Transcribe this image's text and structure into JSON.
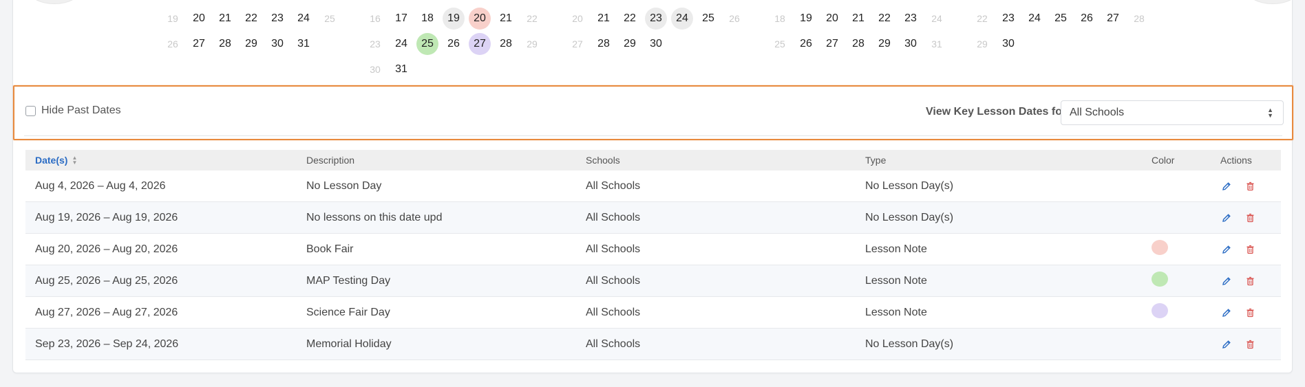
{
  "calendar": {
    "months": [
      {
        "weeks": [
          [
            {
              "d": "19",
              "m": true
            },
            {
              "d": "20"
            },
            {
              "d": "21"
            },
            {
              "d": "22"
            },
            {
              "d": "23"
            },
            {
              "d": "24"
            },
            {
              "d": "25",
              "m": true
            }
          ],
          [
            {
              "d": "26",
              "m": true
            },
            {
              "d": "27"
            },
            {
              "d": "28"
            },
            {
              "d": "29"
            },
            {
              "d": "30"
            },
            {
              "d": "31"
            },
            {
              "d": ""
            }
          ]
        ]
      },
      {
        "weeks": [
          [
            {
              "d": "16",
              "m": true
            },
            {
              "d": "17"
            },
            {
              "d": "18"
            },
            {
              "d": "19",
              "bg": "#ebebeb"
            },
            {
              "d": "20",
              "bg": "#f8d0ca"
            },
            {
              "d": "21"
            },
            {
              "d": "22",
              "m": true
            }
          ],
          [
            {
              "d": "23",
              "m": true
            },
            {
              "d": "24"
            },
            {
              "d": "25",
              "bg": "#bfe8b4"
            },
            {
              "d": "26"
            },
            {
              "d": "27",
              "bg": "#dcd3f5"
            },
            {
              "d": "28"
            },
            {
              "d": "29",
              "m": true
            }
          ],
          [
            {
              "d": "30",
              "m": true
            },
            {
              "d": "31"
            },
            {
              "d": ""
            },
            {
              "d": ""
            },
            {
              "d": ""
            },
            {
              "d": ""
            },
            {
              "d": ""
            }
          ]
        ]
      },
      {
        "weeks": [
          [
            {
              "d": "20",
              "m": true
            },
            {
              "d": "21"
            },
            {
              "d": "22"
            },
            {
              "d": "23",
              "bg": "#ebebeb"
            },
            {
              "d": "24",
              "bg": "#ebebeb"
            },
            {
              "d": "25"
            },
            {
              "d": "26",
              "m": true
            }
          ],
          [
            {
              "d": "27",
              "m": true
            },
            {
              "d": "28"
            },
            {
              "d": "29"
            },
            {
              "d": "30"
            },
            {
              "d": ""
            },
            {
              "d": ""
            },
            {
              "d": ""
            }
          ]
        ]
      },
      {
        "weeks": [
          [
            {
              "d": "18",
              "m": true
            },
            {
              "d": "19"
            },
            {
              "d": "20"
            },
            {
              "d": "21"
            },
            {
              "d": "22"
            },
            {
              "d": "23"
            },
            {
              "d": "24",
              "m": true
            }
          ],
          [
            {
              "d": "25",
              "m": true
            },
            {
              "d": "26"
            },
            {
              "d": "27"
            },
            {
              "d": "28"
            },
            {
              "d": "29"
            },
            {
              "d": "30"
            },
            {
              "d": "31",
              "m": true
            }
          ]
        ]
      },
      {
        "weeks": [
          [
            {
              "d": "22",
              "m": true
            },
            {
              "d": "23"
            },
            {
              "d": "24"
            },
            {
              "d": "25"
            },
            {
              "d": "26"
            },
            {
              "d": "27"
            },
            {
              "d": "28",
              "m": true
            }
          ],
          [
            {
              "d": "29",
              "m": true
            },
            {
              "d": "30"
            },
            {
              "d": ""
            },
            {
              "d": ""
            },
            {
              "d": ""
            },
            {
              "d": ""
            },
            {
              "d": ""
            }
          ]
        ]
      }
    ]
  },
  "filter": {
    "hide_past_label": "Hide Past Dates",
    "hide_past_checked": false,
    "view_label": "View Key Lesson Dates for",
    "school_select_value": "All Schools"
  },
  "table": {
    "headers": {
      "dates": "Date(s)",
      "description": "Description",
      "schools": "Schools",
      "type": "Type",
      "color": "Color",
      "actions": "Actions"
    },
    "rows": [
      {
        "dates": "Aug 4, 2026 – Aug 4, 2026",
        "description": "No Lesson Day",
        "schools": "All Schools",
        "type": "No Lesson Day(s)",
        "color": ""
      },
      {
        "dates": "Aug 19, 2026 – Aug 19, 2026",
        "description": "No lessons on this date upd",
        "schools": "All Schools",
        "type": "No Lesson Day(s)",
        "color": ""
      },
      {
        "dates": "Aug 20, 2026 – Aug 20, 2026",
        "description": "Book Fair",
        "schools": "All Schools",
        "type": "Lesson Note",
        "color": "#f8d0ca"
      },
      {
        "dates": "Aug 25, 2026 – Aug 25, 2026",
        "description": "MAP Testing Day",
        "schools": "All Schools",
        "type": "Lesson Note",
        "color": "#bfe8b4"
      },
      {
        "dates": "Aug 27, 2026 – Aug 27, 2026",
        "description": "Science Fair Day",
        "schools": "All Schools",
        "type": "Lesson Note",
        "color": "#dcd3f5"
      },
      {
        "dates": "Sep 23, 2026 – Sep 24, 2026",
        "description": "Memorial Holiday",
        "schools": "All Schools",
        "type": "No Lesson Day(s)",
        "color": ""
      }
    ]
  },
  "colors": {
    "accent": "#2b6cc4",
    "delete": "#d9534f",
    "highlight_border": "#e88a3e"
  }
}
